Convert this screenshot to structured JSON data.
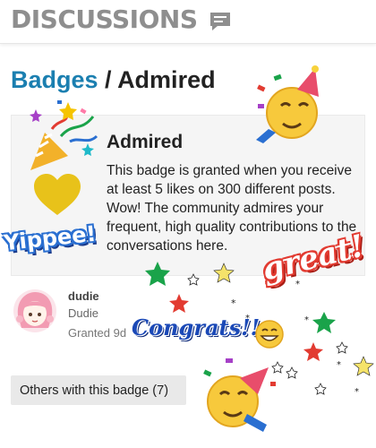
{
  "header": {
    "title": "DISCUSSIONS",
    "icon": "chat-bubble-icon"
  },
  "breadcrumb": {
    "parent": "Badges",
    "separator": " / ",
    "current": "Admired"
  },
  "badge": {
    "name": "Admired",
    "description": "This badge is granted when you receive at least 5 likes on 300 different posts. Wow! The community admires your frequent, high quality contributions to the conversations here.",
    "icon": "heart-icon",
    "icon_color": "#e8c21a"
  },
  "recipient": {
    "handle": "dudie",
    "name": "Dudie",
    "granted": "Granted 9d"
  },
  "others_button": {
    "label": "Others with this badge (7)"
  },
  "stickers": {
    "yippee": "Yippee!",
    "great": "great!",
    "congrats": "Congrats!!"
  },
  "colors": {
    "link": "#1b7fb0",
    "accent_red": "#e23b31",
    "accent_blue": "#1b49b7"
  }
}
